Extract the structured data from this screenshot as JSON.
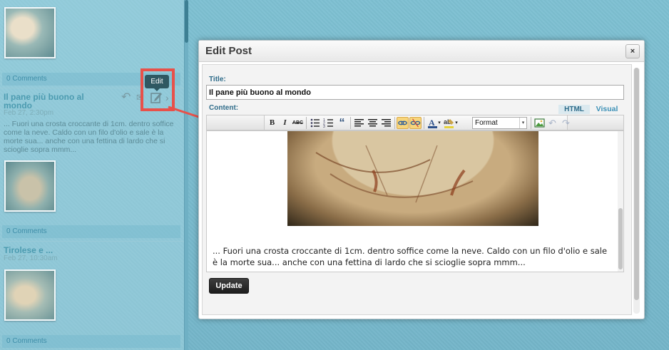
{
  "feed": {
    "posts": [
      {
        "comments": "0 Comments"
      },
      {
        "title": "Il pane più buono al mondo",
        "date": "Feb 27, 2:30pm",
        "excerpt": "... Fuori una crosta croccante di 1cm. dentro soffice come la neve. Caldo con un filo d'olio e sale è la morte sua... anche con una fettina di lardo che si scioglie sopra mmm...",
        "comments": "0 Comments",
        "tooltip": "Edit"
      },
      {
        "title": "Tirolese e ...",
        "date": "Feb 27, 10:30am",
        "comments": "0 Comments"
      }
    ]
  },
  "modal": {
    "title": "Edit Post",
    "close_label": "×",
    "title_label": "Title:",
    "title_value": "Il pane più buono al mondo",
    "content_label": "Content:",
    "mode_html": "HTML",
    "mode_visual": "Visual",
    "format_value": "Format",
    "toolbar": {
      "bold": "B",
      "italic": "I",
      "strike": "ABC",
      "quote": "“"
    },
    "editor_text": "... Fuori una crosta croccante di 1cm. dentro soffice come la neve. Caldo con un filo d'olio e sale è la morte sua... anche con una fettina di lardo che si scioglie sopra mmm...",
    "update_label": "Update"
  },
  "colors": {
    "highlight": "#e8514a",
    "background": "#7dbccf",
    "link": "#3d91b7"
  }
}
